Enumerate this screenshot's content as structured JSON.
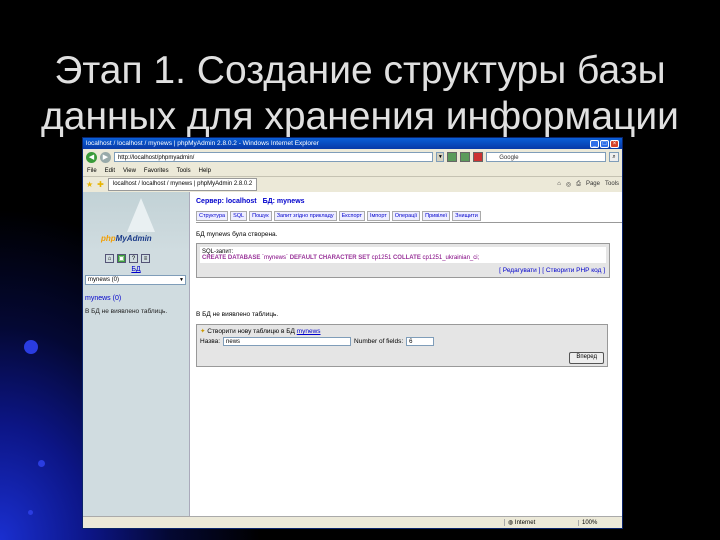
{
  "slide": {
    "title_line1": "Этап 1. Создание структуры базы",
    "title_line2": "данных для хранения информации"
  },
  "browser": {
    "window_title": "localhost / localhost / mynews | phpMyAdmin 2.8.0.2 - Windows Internet Explorer",
    "address": "http://localhost/phpmyadmin/",
    "search_placeholder": "Google",
    "menu": [
      "File",
      "Edit",
      "View",
      "Favorites",
      "Tools",
      "Help"
    ],
    "tab_title": "localhost / localhost / mynews | phpMyAdmin 2.8.0.2",
    "tools": [
      "Page",
      "Tools"
    ],
    "status_done": "",
    "status_zone": "Internet",
    "status_zoom": "100%"
  },
  "pma": {
    "logo_php": "php",
    "logo_myadmin": "MyAdmin",
    "left_db_label": "БД",
    "left_select_value": "mynews (0)",
    "left_db_name": "mynews (0)",
    "left_no_tables": "В БД не виявлено таблиць.",
    "breadcrumb_server": "Сервер: localhost",
    "breadcrumb_db": "БД: mynews",
    "tabs": [
      "Структура",
      "SQL",
      "Пошук",
      "Запит згідно прикладу",
      "Експорт",
      "Імпорт",
      "Операції",
      "Привілеї",
      "Знищити"
    ],
    "msg_created": "БД mynews була створена.",
    "sql_head": "SQL-запит:",
    "sql_kw1": "CREATE DATABASE",
    "sql_name": "`mynews`",
    "sql_kw2": "DEFAULT CHARACTER SET",
    "sql_cs": "cp1251",
    "sql_kw3": "COLLATE",
    "sql_coll": "cp1251_ukrainian_ci;",
    "sql_links": "[ Редагувати ] [ Створити PHP код ]",
    "msg_no_tables": "В БД не виявлено таблиць.",
    "create_title_prefix": "Створити нову таблицю в БД",
    "create_title_db": "mynews",
    "name_label": "Назва:",
    "name_value": "news",
    "fields_label": "Number of fields:",
    "fields_value": "6",
    "go_button": "Вперед"
  }
}
